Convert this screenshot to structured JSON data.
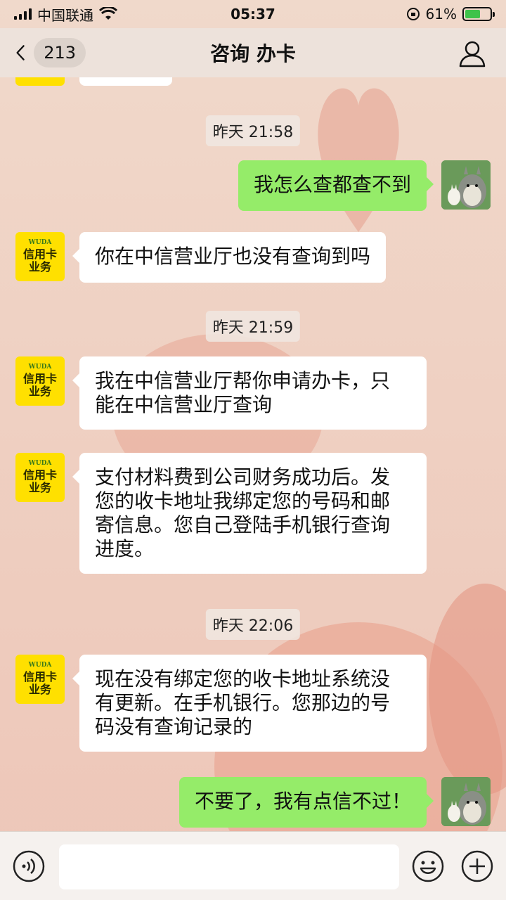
{
  "status_bar": {
    "carrier": "中国联通",
    "time": "05:37",
    "battery": "61%",
    "battery_level": 0.61
  },
  "nav": {
    "back_count": "213",
    "title": "咨询 办卡"
  },
  "service_avatar": {
    "logo": "WUDA",
    "line1": "信用卡",
    "line2": "业务"
  },
  "messages": {
    "t1": "昨天 21:58",
    "m1": "我怎么查都查不到",
    "m2": "你在中信营业厅也没有查询到吗",
    "t2": "昨天 21:59",
    "m3_l1": "我在中信营业厅帮你申请办卡，只",
    "m3_l2": "能在中信营业厅查询",
    "m4_l1": "支付材料费到公司财务成功后。发",
    "m4_l2": "您的收卡地址我绑定您的号码和邮",
    "m4_l3": "寄信息。您自己登陆手机银行查询",
    "m4_l4": "进度。",
    "t3": "昨天 22:06",
    "m5_l1": "现在没有绑定您的收卡地址系统没",
    "m5_l2": "有更新。在手机银行。您那边的号",
    "m5_l3": "码没有查询记录的",
    "m6": "不要了，我有点信不过！"
  },
  "input": {
    "placeholder": ""
  },
  "icons": {
    "back": "chevron-left-icon",
    "profile": "person-icon",
    "voice": "voice-icon",
    "emoji": "emoji-icon",
    "plus": "plus-icon"
  },
  "colors": {
    "outgoing_bubble": "#95ec69",
    "incoming_bubble": "#ffffff",
    "service_avatar": "#ffe000"
  }
}
